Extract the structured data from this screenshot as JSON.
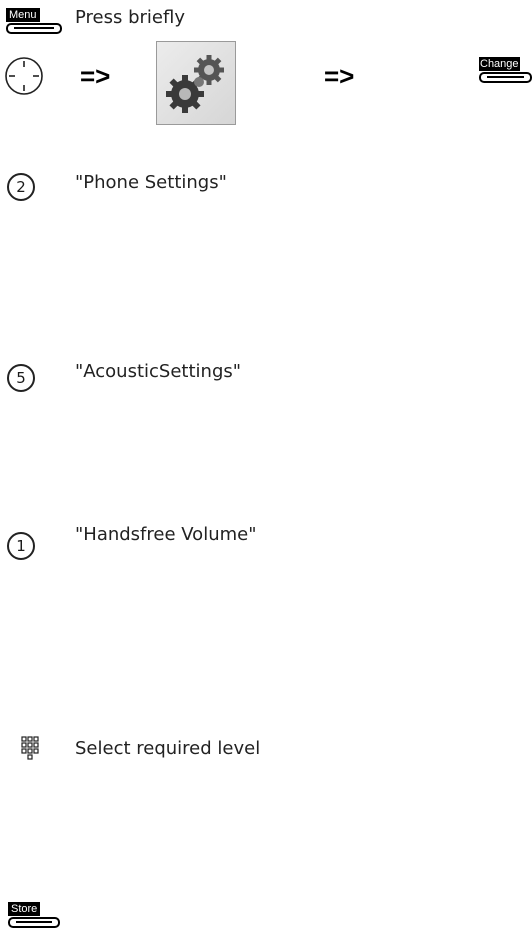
{
  "steps": {
    "menu_key": "Menu",
    "press_briefly": "Press briefly",
    "arrow": "=>",
    "change_key": "Change",
    "step2_number": "2",
    "step2_text": "\"Phone Settings\"",
    "step5_number": "5",
    "step5_text": "\"AcousticSettings\"",
    "step1_number": "1",
    "step1_text": "\"Handsfree Volume\"",
    "keypad_text": "Select required level",
    "store_key": "Store"
  },
  "icons": {
    "nav": "navigation-key-icon",
    "settings": "settings-gears-icon",
    "keypad": "keypad-icon"
  }
}
